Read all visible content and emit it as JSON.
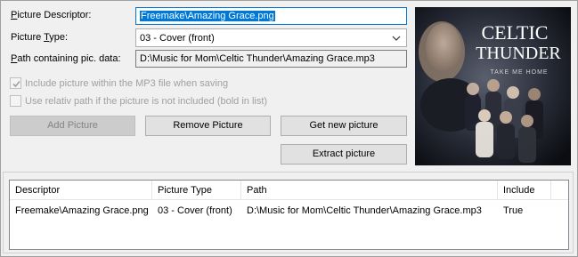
{
  "form": {
    "descriptor_label_u": "P",
    "descriptor_label_rest": "icture Descriptor:",
    "descriptor_value": "Freemake\\Amazing Grace.png",
    "type_label_a": "Picture ",
    "type_label_u": "T",
    "type_label_b": "ype:",
    "type_value": "03 - Cover (front)",
    "path_label_u": "P",
    "path_label_rest": "ath containing pic. data:",
    "path_value": "D:\\Music for Mom\\Celtic Thunder\\Amazing Grace.mp3",
    "include_mp3_label": "Include picture within the MP3 file when saving",
    "include_mp3_checked": true,
    "relative_path_label": "Use relativ path if the picture is not included (bold in list)",
    "relative_path_checked": false
  },
  "buttons": {
    "add": "Add Picture",
    "remove": "Remove Picture",
    "get_new": "Get new picture",
    "extract": "Extract picture"
  },
  "cover": {
    "title_line1": "CELTIC",
    "title_line2": "THUNDER",
    "subtitle": "TAKE ME HOME"
  },
  "list": {
    "columns": [
      "Descriptor",
      "Picture Type",
      "Path",
      "Include"
    ],
    "rows": [
      [
        "Freemake\\Amazing Grace.png",
        "03 - Cover (front)",
        "D:\\Music for Mom\\Celtic Thunder\\Amazing Grace.mp3",
        "True"
      ]
    ]
  },
  "colors": {
    "accent": "#0078d7",
    "window_bg": "#f0f0f0"
  }
}
